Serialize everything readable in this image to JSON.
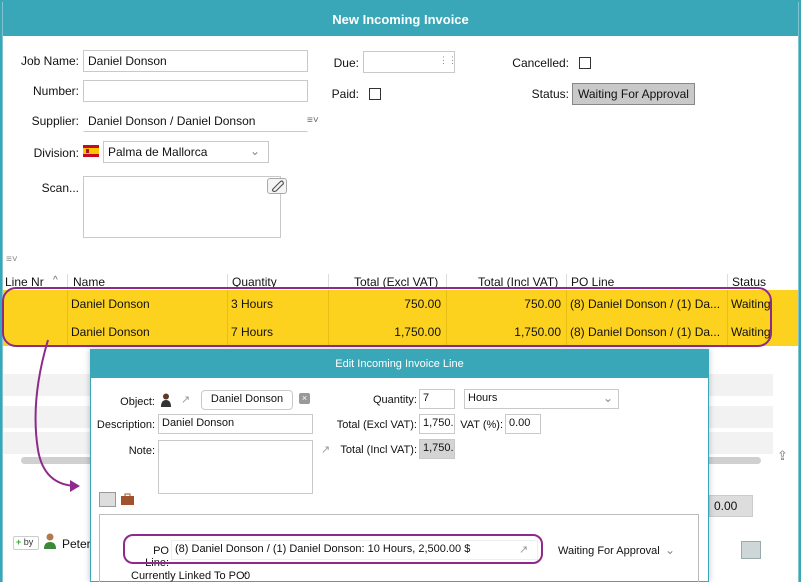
{
  "window": {
    "title": "New Incoming Invoice"
  },
  "form": {
    "job_name_label": "Job Name:",
    "job_name_value": "Daniel Donson",
    "number_label": "Number:",
    "number_value": "",
    "supplier_label": "Supplier:",
    "supplier_value": "Daniel Donson / Daniel Donson",
    "division_label": "Division:",
    "division_value": "Palma de Mallorca",
    "scan_label": "Scan...",
    "due_label": "Due:",
    "due_value": "",
    "paid_label": "Paid:",
    "cancelled_label": "Cancelled:",
    "status_label": "Status:",
    "status_value": "Waiting For Approval"
  },
  "grid": {
    "columns": [
      "Line Nr",
      "Name",
      "Quantity",
      "Total (Excl VAT)",
      "Total (Incl VAT)",
      "PO Line",
      "Status"
    ],
    "rows": [
      {
        "line_nr": "",
        "name": "Daniel Donson",
        "quantity": "3 Hours",
        "total_excl": "750.00",
        "total_incl": "750.00",
        "po_line": "(8) Daniel Donson / (1) Da...",
        "status": "Waiting"
      },
      {
        "line_nr": "",
        "name": "Daniel Donson",
        "quantity": "7 Hours",
        "total_excl": "1,750.00",
        "total_incl": "1,750.00",
        "po_line": "(8) Daniel Donson / (1) Da...",
        "status": "Waiting"
      }
    ]
  },
  "footer": {
    "by_label": "by",
    "user_name": "Peter",
    "total_value": "0.00"
  },
  "dialog": {
    "title": "Edit Incoming Invoice Line",
    "object_label": "Object:",
    "object_value": "Daniel Donson",
    "description_label": "Description:",
    "description_value": "Daniel Donson",
    "note_label": "Note:",
    "quantity_label": "Quantity:",
    "quantity_value": "7",
    "unit_value": "Hours",
    "total_excl_label": "Total (Excl VAT):",
    "total_excl_value": "1,750.0",
    "vat_label": "VAT (%):",
    "vat_value": "0.00",
    "total_incl_label": "Total (Incl VAT):",
    "total_incl_value": "1,750.0",
    "po_line_label": "PO Line:",
    "po_line_value": "(8) Daniel Donson / (1) Daniel Donson: 10 Hours, 2,500.00 $",
    "po_status": "Waiting For Approval",
    "linked_label": "Currently Linked To PO:",
    "linked_value": "0"
  },
  "colors": {
    "accent": "#3aa7b8",
    "row_highlight": "#fcd21e",
    "annotation": "#8e2a8c"
  }
}
